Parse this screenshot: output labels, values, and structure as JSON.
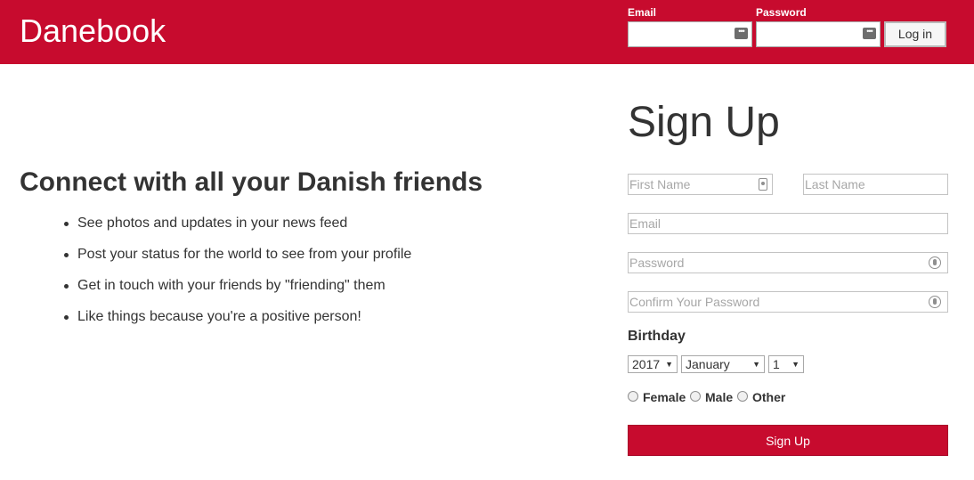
{
  "header": {
    "brand": "Danebook",
    "email_label": "Email",
    "password_label": "Password",
    "login_button": "Log in"
  },
  "intro": {
    "headline": "Connect with all your Danish friends",
    "features": [
      "See photos and updates in your news feed",
      "Post your status for the world to see from your profile",
      "Get in touch with your friends by \"friending\" them",
      "Like things because you're a positive person!"
    ]
  },
  "signup": {
    "title": "Sign Up",
    "first_name_placeholder": "First Name",
    "last_name_placeholder": "Last Name",
    "email_placeholder": "Email",
    "password_placeholder": "Password",
    "confirm_password_placeholder": "Confirm Your Password",
    "birthday_label": "Birthday",
    "year": "2017",
    "month": "January",
    "day": "1",
    "gender_options": [
      "Female",
      "Male",
      "Other"
    ],
    "submit_label": "Sign Up"
  },
  "colors": {
    "brand_red": "#c70b2e"
  }
}
